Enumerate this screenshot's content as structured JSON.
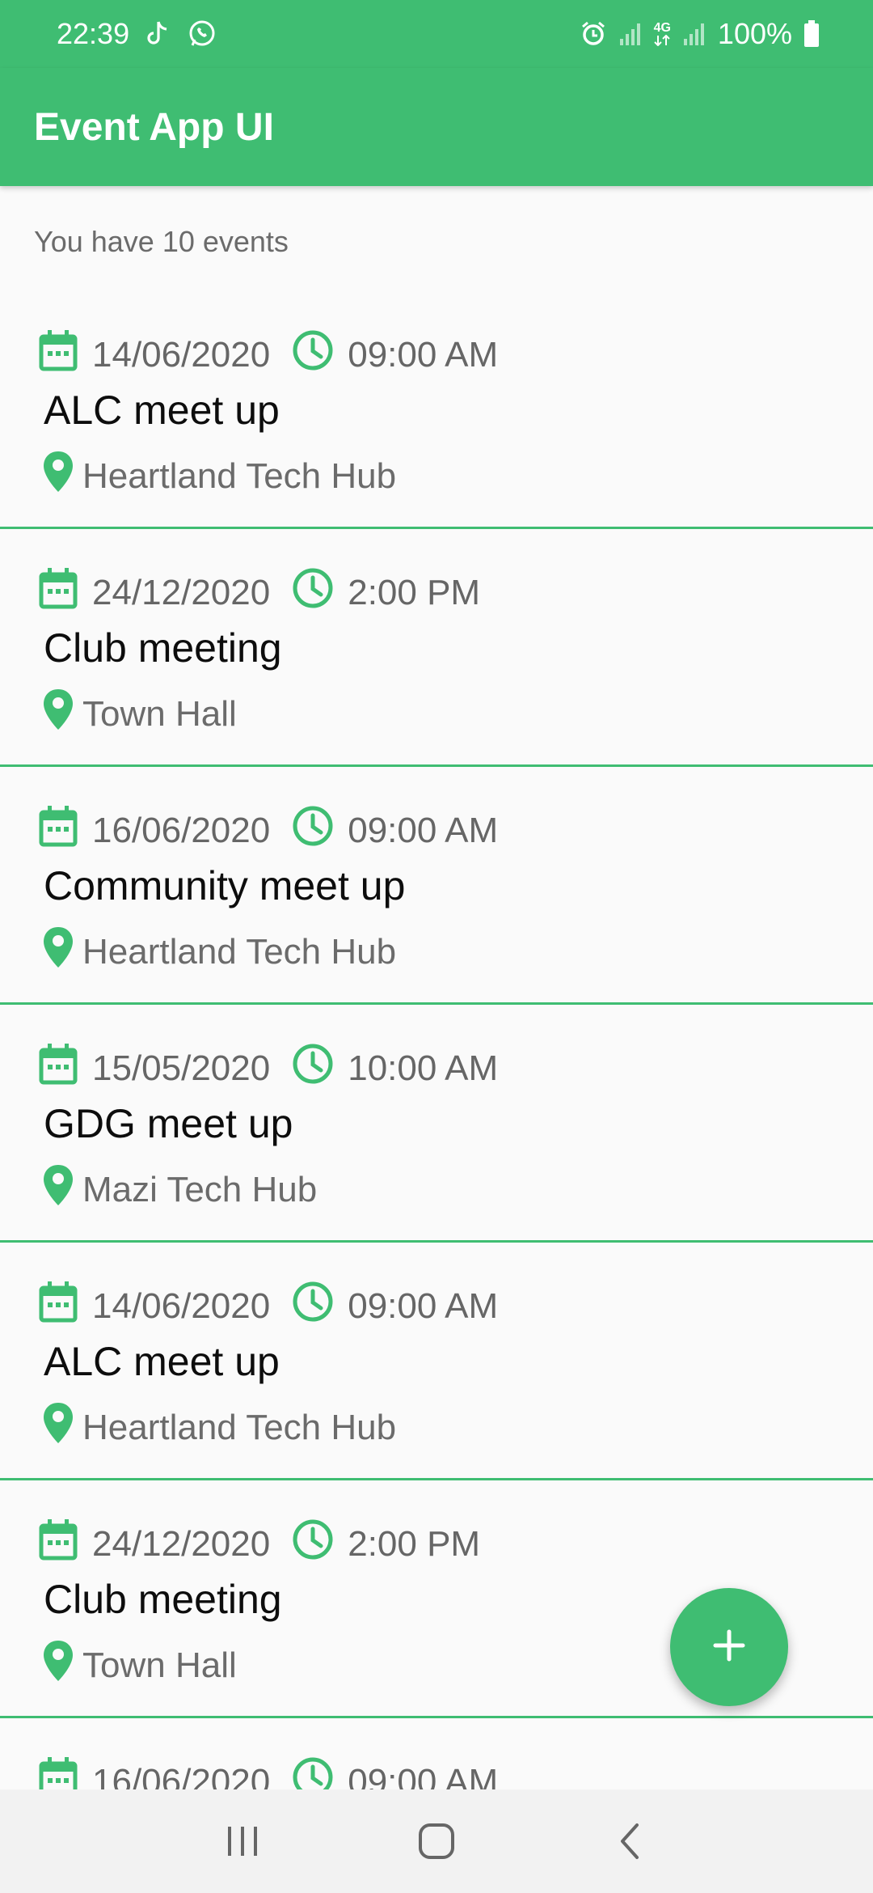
{
  "status_bar": {
    "time": "22:39",
    "battery": "100%",
    "network": "4G"
  },
  "app_bar": {
    "title": "Event App UI"
  },
  "events_count_text": "You have 10 events",
  "events": [
    {
      "date": "14/06/2020",
      "time": "09:00 AM",
      "title": "ALC meet up",
      "location": "Heartland Tech Hub"
    },
    {
      "date": "24/12/2020",
      "time": "2:00 PM",
      "title": "Club meeting",
      "location": "Town Hall"
    },
    {
      "date": "16/06/2020",
      "time": "09:00 AM",
      "title": "Community meet up",
      "location": "Heartland Tech Hub"
    },
    {
      "date": "15/05/2020",
      "time": "10:00 AM",
      "title": "GDG meet up",
      "location": "Mazi Tech Hub"
    },
    {
      "date": "14/06/2020",
      "time": "09:00 AM",
      "title": "ALC meet up",
      "location": "Heartland Tech Hub"
    },
    {
      "date": "24/12/2020",
      "time": "2:00 PM",
      "title": "Club meeting",
      "location": "Town Hall"
    },
    {
      "date": "16/06/2020",
      "time": "09:00 AM",
      "title": "",
      "location": ""
    }
  ],
  "icons": {
    "date": "calendar-icon",
    "time": "clock-icon",
    "location": "location-pin-icon",
    "fab": "plus-icon"
  },
  "colors": {
    "accent": "#3fbd72",
    "background": "#fafafa"
  }
}
